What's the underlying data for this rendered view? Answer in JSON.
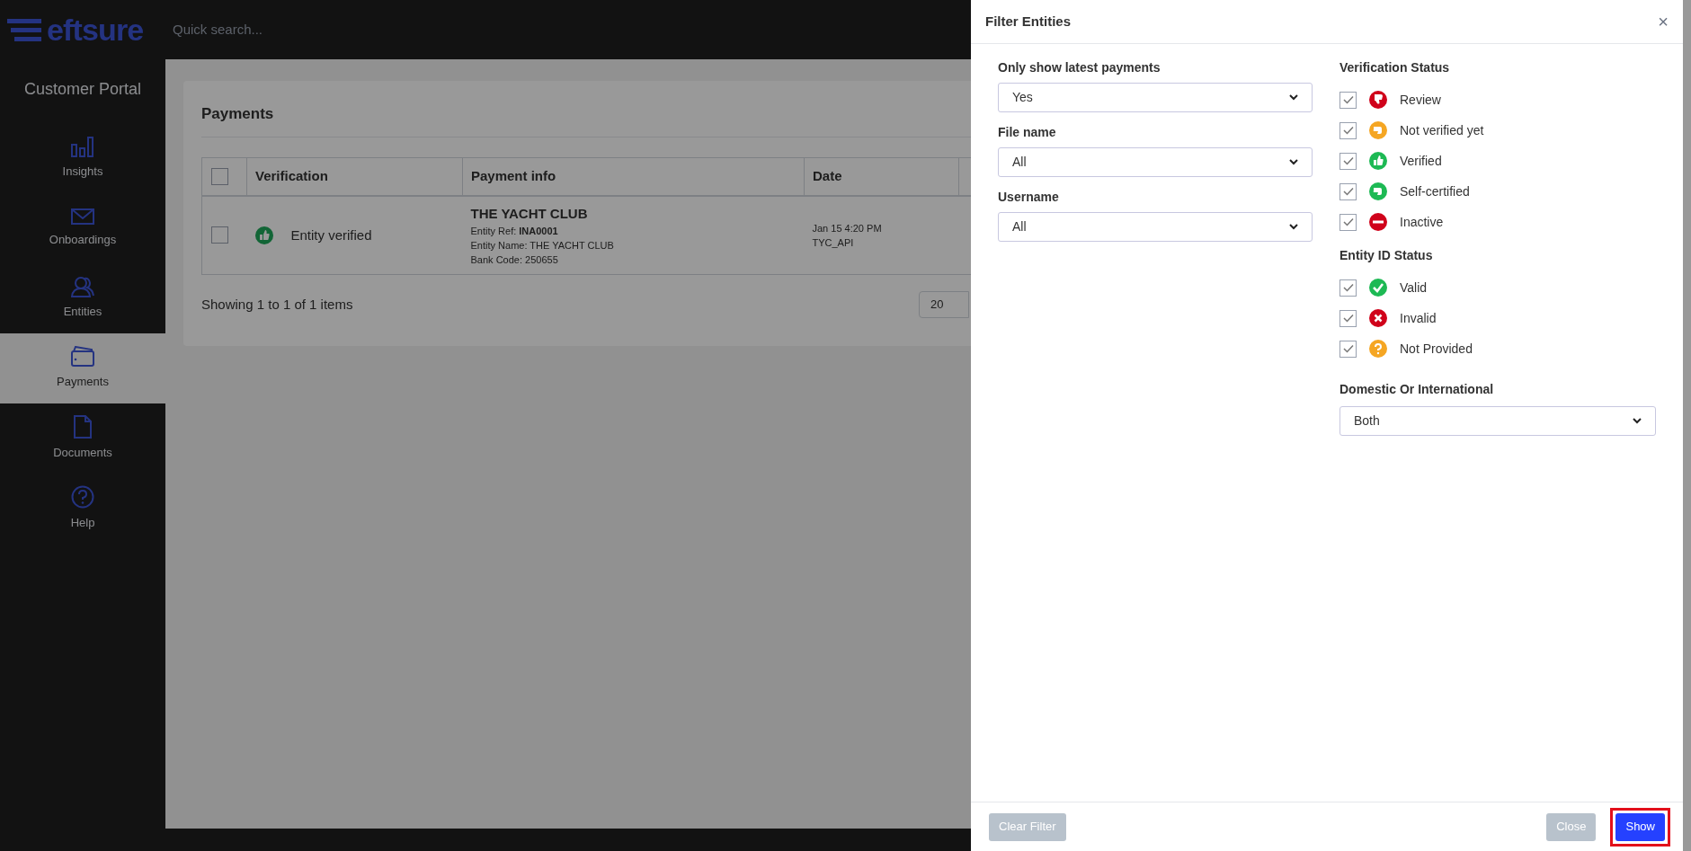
{
  "header": {
    "logo": "eftsure",
    "search": {
      "placeholder": "Quick search..."
    }
  },
  "sidebar": {
    "title": "Customer Portal",
    "items": [
      {
        "label": "Insights",
        "selected": false
      },
      {
        "label": "Onboardings",
        "selected": false
      },
      {
        "label": "Entities",
        "selected": false
      },
      {
        "label": "Payments",
        "selected": true
      },
      {
        "label": "Documents",
        "selected": false
      },
      {
        "label": "Help",
        "selected": false
      }
    ]
  },
  "payments": {
    "title": "Payments",
    "table": {
      "select_all_checked": false,
      "columns": [
        "Verification",
        "Payment info",
        "Date"
      ],
      "rows": [
        {
          "checked": false,
          "verification": "Entity verified",
          "payee": "THE YACHT CLUB",
          "details": [
            "Entity Ref: **INA0001**",
            "Entity Name: THE YACHT CLUB",
            "Bank Code: 250655"
          ],
          "date": "Jan 15 4:20 PM",
          "user": "TYC_API"
        }
      ]
    },
    "summary": "Showing 1 to 1 of 1 items",
    "page_size": "20"
  },
  "filter_panel": {
    "title": "Filter Entities",
    "close": "×",
    "fields": [
      {
        "label": "Only show latest payments",
        "value": "Yes"
      },
      {
        "label": "File name",
        "value": "All"
      },
      {
        "label": "Username",
        "value": "All"
      }
    ],
    "groups": [
      {
        "title": "Verification Status",
        "options": [
          {
            "label": "Review",
            "checked": true,
            "kind": "thumbs-down",
            "color": "#d0021b"
          },
          {
            "label": "Not verified yet",
            "checked": true,
            "kind": "hand",
            "color": "#f5a623"
          },
          {
            "label": "Verified",
            "checked": true,
            "kind": "thumbs-up",
            "color": "#1db954"
          },
          {
            "label": "Self-certified",
            "checked": true,
            "kind": "hand",
            "color": "#1db954"
          },
          {
            "label": "Inactive",
            "checked": true,
            "kind": "minus",
            "color": "#d0021b"
          }
        ]
      },
      {
        "title": "Entity ID Status",
        "options": [
          {
            "label": "Valid",
            "checked": true,
            "kind": "tick",
            "color": "#1db954"
          },
          {
            "label": "Invalid",
            "checked": true,
            "kind": "cross",
            "color": "#d0021b"
          },
          {
            "label": "Not Provided",
            "checked": true,
            "kind": "question",
            "color": "#f5a623"
          }
        ]
      }
    ],
    "region": {
      "label": "Domestic Or International",
      "value": "Both"
    },
    "buttons": [
      {
        "label": "Clear Filter",
        "kind": "secondary",
        "highlighted": false
      },
      {
        "label": "Close",
        "kind": "secondary",
        "highlighted": false
      },
      {
        "label": "Show",
        "kind": "primary",
        "highlighted": true
      }
    ]
  }
}
